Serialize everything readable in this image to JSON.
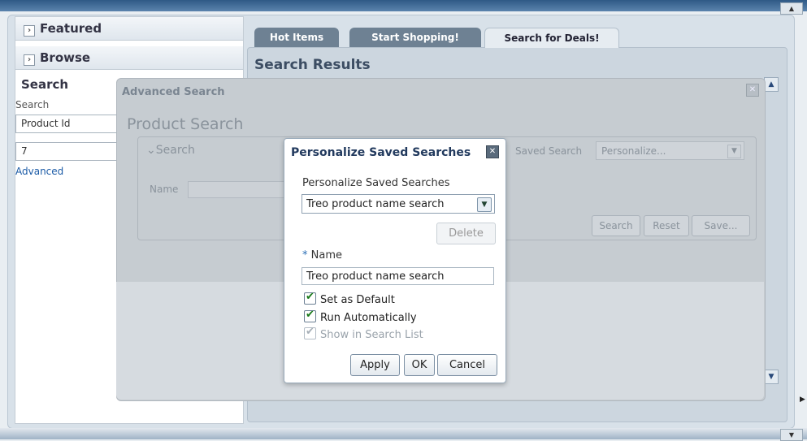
{
  "left_panel": {
    "accordions": [
      {
        "label": "Featured"
      },
      {
        "label": "Browse"
      }
    ],
    "search_header": "Search",
    "search_label": "Search",
    "field_selector": "Product Id",
    "field_value": "7",
    "advanced_link": "Advanced"
  },
  "tabs": [
    {
      "label": "Hot Items"
    },
    {
      "label": "Start Shopping!"
    },
    {
      "label": "Search for Deals!",
      "selected": true
    }
  ],
  "results_title": "Search Results",
  "advanced_search": {
    "title": "Advanced Search",
    "section_title": "Product Search",
    "search_toggle": "Search",
    "name_label": "Name",
    "saved_search_label": "Saved Search",
    "saved_search_value": "Personalize...",
    "buttons": {
      "search": "Search",
      "reset": "Reset",
      "save": "Save..."
    }
  },
  "personalize_dialog": {
    "title": "Personalize Saved Searches",
    "select_label": "Personalize Saved Searches",
    "select_value": "Treo product name search",
    "delete_label": "Delete",
    "name_label": "Name",
    "required_mark": "*",
    "name_value": "Treo product name search",
    "checkboxes": [
      {
        "label": "Set as Default",
        "checked": true,
        "enabled": true
      },
      {
        "label": "Run Automatically",
        "checked": true,
        "enabled": true
      },
      {
        "label": "Show in Search List",
        "checked": true,
        "enabled": false
      }
    ],
    "buttons": {
      "apply": "Apply",
      "ok": "OK",
      "cancel": "Cancel"
    }
  },
  "icons": {
    "close": "close-icon",
    "dropdown": "chevron-down-icon",
    "expand": "chevron-right-icon",
    "collapse": "chevron-down-icon",
    "check": "checkmark-icon"
  },
  "colors": {
    "title_bar": "#2f5a86",
    "tab_inactive": "#6e8193",
    "link": "#1a5aa6",
    "dialog_title": "#223a5e",
    "checkmark": "#1a7a1a"
  }
}
